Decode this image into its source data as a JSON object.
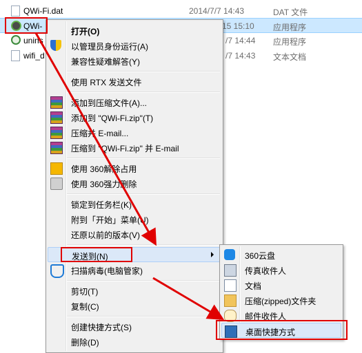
{
  "files": [
    {
      "name": "",
      "date": "",
      "type": ""
    },
    {
      "name": "QWi-Fi.dat",
      "date": "2014/7/7 14:43",
      "type": "DAT 文件"
    },
    {
      "name": "QWi-",
      "date": "15 15:10",
      "type": "应用程序"
    },
    {
      "name": "unins",
      "date": "/7 14:44",
      "type": "应用程序"
    },
    {
      "name": "wifi_d",
      "date": "/7 14:43",
      "type": "文本文档"
    }
  ],
  "menu": {
    "open": "打开(O)",
    "run_as_admin": "以管理员身份运行(A)",
    "troubleshoot": "兼容性疑难解答(Y)",
    "rtx_send": "使用 RTX 发送文件",
    "add_archive": "添加到压缩文件(A)...",
    "add_zip": "添加到 \"QWi-Fi.zip\"(T)",
    "compress_email": "压缩并 E-mail...",
    "compress_zip_email": "压缩到 \"QWi-Fi.zip\" 并 E-mail",
    "unlock_360": "使用 360解除占用",
    "delete_360": "使用 360强力删除",
    "pin_taskbar": "锁定到任务栏(K)",
    "pin_start": "附到「开始」菜单(U)",
    "restore_prev": "还原以前的版本(V)",
    "send_to": "发送到(N)",
    "scan_virus": "扫描病毒(电脑管家)",
    "cut": "剪切(T)",
    "copy": "复制(C)",
    "create_shortcut": "创建快捷方式(S)",
    "delete": "删除(D)"
  },
  "submenu": {
    "cloud360": "360云盘",
    "fax": "传真收件人",
    "documents": "文档",
    "zip_folder": "压缩(zipped)文件夹",
    "mail": "邮件收件人",
    "desktop_shortcut": "桌面快捷方式"
  },
  "colors": {
    "annotation_red": "#e00000",
    "highlight_bg": "#dbe8f8",
    "selection_bg": "#cce8ff",
    "menu_bg": "#f0f0f0"
  }
}
